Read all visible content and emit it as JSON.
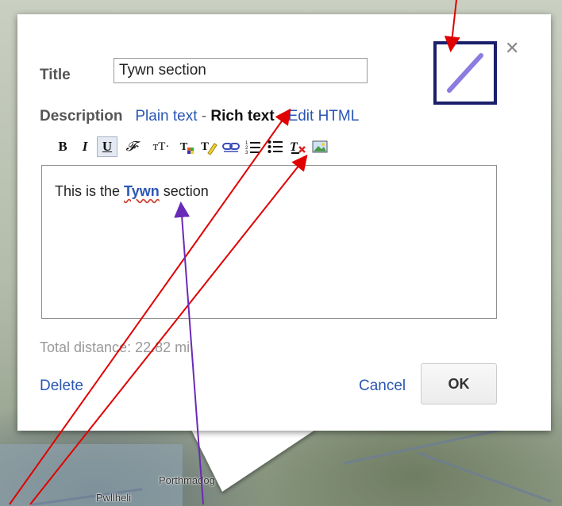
{
  "map": {
    "labels": {
      "porthmadog": "Porthmadog",
      "pwllheli": "Pwllheli"
    }
  },
  "dialog": {
    "title_label": "Title",
    "title_value": "Tywn section",
    "description_label": "Description",
    "modes": {
      "plain_text": "Plain text",
      "separator": "-",
      "rich_text": "Rich text",
      "edit_html": "Edit HTML",
      "selected": "Rich text"
    },
    "toolbar": {
      "bold": "B",
      "italic": "I",
      "underline": "U",
      "font_family": "𝓕·",
      "font_size": "тT·",
      "text_color_icon": "text-color-icon",
      "highlight_icon": "highlight-color-icon",
      "link_icon": "link-icon",
      "numbered_list_icon": "numbered-list-icon",
      "bulleted_list_icon": "bulleted-list-icon",
      "remove_format_icon": "remove-formatting-icon",
      "image_icon": "insert-image-icon",
      "active": [
        "underline"
      ]
    },
    "editor": {
      "text_before": "This is the ",
      "link_text": "Tywn",
      "text_after": " section"
    },
    "distance": "Total distance: 22.82 mi",
    "delete_label": "Delete",
    "cancel_label": "Cancel",
    "ok_label": "OK",
    "close_icon": "close-icon",
    "style_icon": "line-style-icon"
  },
  "colors": {
    "link": "#2a57b4",
    "annotation_red": "#e00000",
    "annotation_purple": "#6a2ab8",
    "icon_frame": "#1c1f6b",
    "line_swatch": "#8a7ce0"
  }
}
